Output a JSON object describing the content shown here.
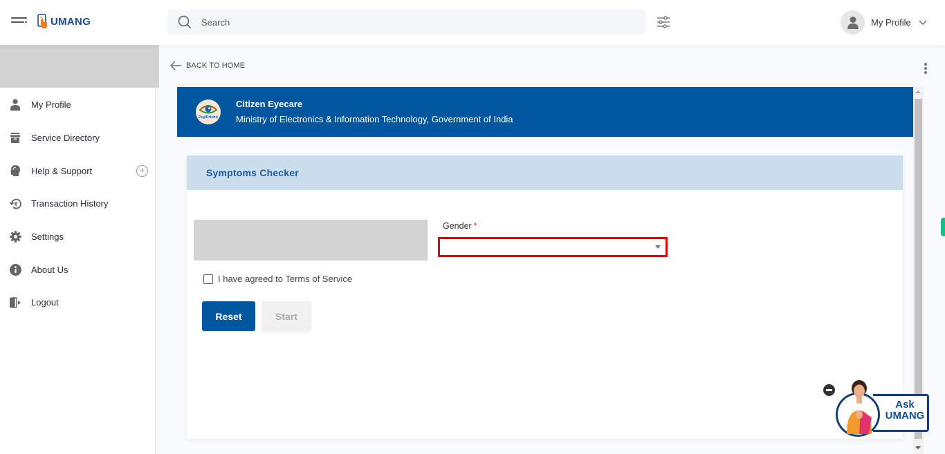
{
  "header": {
    "app_name": "UMANG",
    "search_placeholder": "Search",
    "profile_label": "My Profile"
  },
  "sidebar": {
    "items": [
      {
        "label": "My Profile",
        "icon": "user-icon"
      },
      {
        "label": "Service Directory",
        "icon": "archive-icon"
      },
      {
        "label": "Help & Support",
        "icon": "headset-icon",
        "expand": "+"
      },
      {
        "label": "Transaction History",
        "icon": "rupee-history-icon"
      },
      {
        "label": "Settings",
        "icon": "gear-icon"
      },
      {
        "label": "About Us",
        "icon": "info-icon"
      },
      {
        "label": "Logout",
        "icon": "logout-icon"
      }
    ]
  },
  "main": {
    "back_label": "BACK TO HOME",
    "department": {
      "title": "Citizen Eyecare",
      "subtitle": "Ministry of Electronics & Information Technology, Government of India",
      "logo_text": "DigiDrishti"
    },
    "card": {
      "title": "Symptoms Checker",
      "gender_label": "Gender",
      "gender_required_mark": "*",
      "gender_value": "",
      "terms_label": "I have agreed to Terms of Service",
      "terms_checked": false,
      "reset_label": "Reset",
      "start_label": "Start"
    }
  },
  "chatbot": {
    "line1": "Ask",
    "line2": "UMANG"
  },
  "colors": {
    "brand_blue": "#0057a0",
    "card_header": "#cadeed",
    "error_red": "#e80000",
    "accent_green": "#10c28a"
  }
}
